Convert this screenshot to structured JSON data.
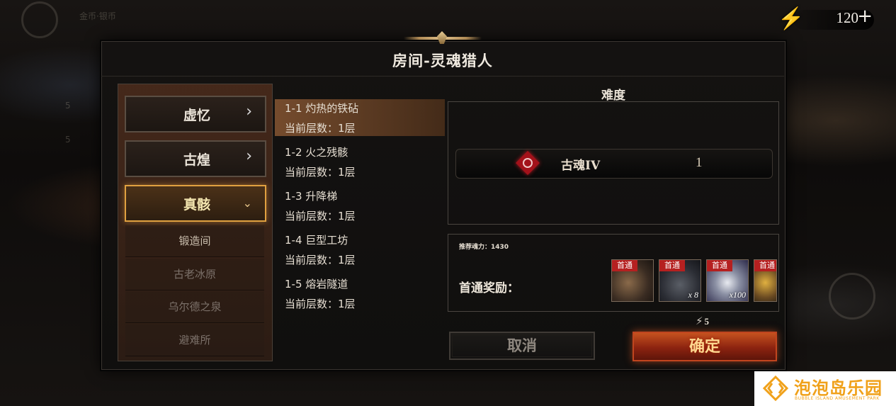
{
  "energy": {
    "value": "120",
    "plus": "+",
    "icon": "lightning-icon"
  },
  "dialog": {
    "title": "房间-灵魂猎人"
  },
  "categories": [
    {
      "label": "虚忆",
      "arrow": "›",
      "state": "collapsed"
    },
    {
      "label": "古煌",
      "arrow": "›",
      "state": "collapsed"
    },
    {
      "label": "真骸",
      "arrow": "⌄",
      "state": "expanded"
    }
  ],
  "subcategories": [
    "锻造间",
    "古老冰原",
    "乌尔德之泉",
    "避难所"
  ],
  "levels": [
    {
      "name": "1-1 灼热的铁砧",
      "floor": "当前层数：1层"
    },
    {
      "name": "1-2 火之残骸",
      "floor": "当前层数：1层"
    },
    {
      "name": "1-3 升降梯",
      "floor": "当前层数：1层"
    },
    {
      "name": "1-4 巨型工坊",
      "floor": "当前层数：1层"
    },
    {
      "name": "1-5 熔岩隧道",
      "floor": "当前层数：1层"
    }
  ],
  "difficulty": {
    "title": "难度",
    "name": "古魂IV",
    "value": "1",
    "emblem_color": "#a3111a"
  },
  "rewards": {
    "recommended": "推荐魂力：1430",
    "label": "首通奖励：",
    "items": [
      {
        "tag": "首通",
        "qty": ""
      },
      {
        "tag": "首通",
        "qty": "x 8"
      },
      {
        "tag": "首通",
        "qty": "x100"
      },
      {
        "tag": "首通",
        "qty": ""
      }
    ]
  },
  "cost": {
    "value": "5"
  },
  "buttons": {
    "cancel": "取消",
    "confirm": "确定"
  },
  "watermark": {
    "title": "泡泡岛乐园",
    "subtitle": "BUBBLE ISLAND AMUSEMENT PARK"
  },
  "background": {
    "items": [
      "金币·银币",
      "5",
      "5"
    ]
  },
  "colors": {
    "accent": "#e0a040",
    "confirm": "#8c2310",
    "tag": "#b52020"
  }
}
